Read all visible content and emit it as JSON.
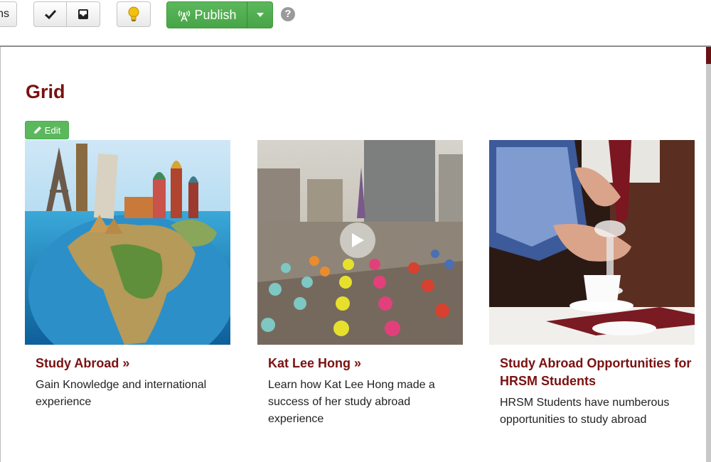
{
  "toolbar": {
    "partial_label": "ns",
    "publish_label": "Publish"
  },
  "page": {
    "heading": "Grid",
    "edit_label": "Edit"
  },
  "cards": [
    {
      "title": "Study Abroad",
      "arrow": "»",
      "description": "Gain Knowledge and international experience"
    },
    {
      "title": "Kat Lee Hong",
      "arrow": "»",
      "description": "Learn how Kat Lee Hong made a success of her study abroad experience"
    },
    {
      "title": "Study Abroad Opportunities for HRSM Students",
      "arrow": "",
      "description": "HRSM Students have numberous opportunities to study abroad"
    }
  ],
  "colors": {
    "heading": "#7a1111",
    "publish": "#5cb85c",
    "edit": "#5cb85c"
  }
}
